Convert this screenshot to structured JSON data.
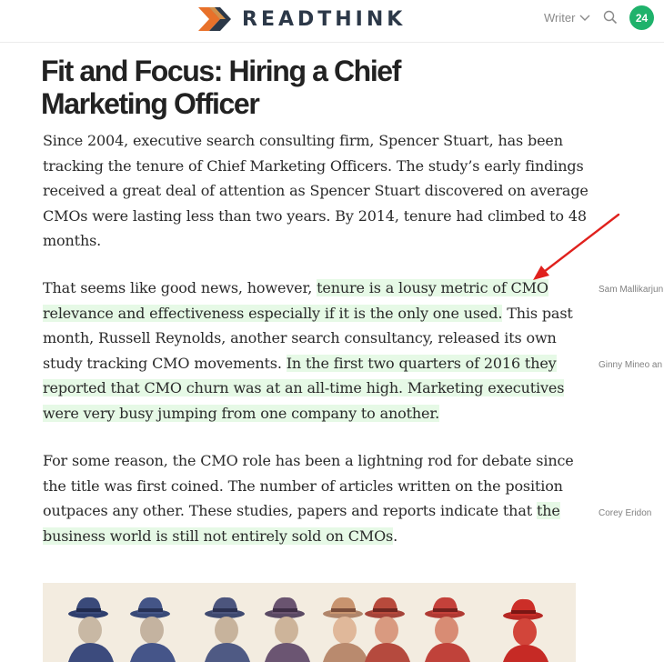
{
  "header": {
    "brand": "READTHINK",
    "writer_label": "Writer",
    "notification_count": "24",
    "brand_colors": {
      "primary": "#2c3848",
      "accent": "#e8712a"
    }
  },
  "article": {
    "title": "Fit and Focus: Hiring a Chief Marketing Officer",
    "paragraphs": [
      {
        "segments": [
          {
            "text": "Since 2004, executive search consulting firm, Spencer Stuart, has been tracking the tenure of Chief Marketing Officers. The study’s early findings received a great deal of attention as Spencer Stuart discovered on average CMOs were lasting less than two years. By 2014, tenure had climbed to 48 months.",
            "highlight": false
          }
        ]
      },
      {
        "segments": [
          {
            "text": "That seems like good news, however, ",
            "highlight": false
          },
          {
            "text": "tenure is a lousy metric of CMO relevance and effectiveness especially if it is the only one used.",
            "highlight": true
          },
          {
            "text": " This past month, Russell Reynolds, another search consultancy, released its own study tracking CMO movements. ",
            "highlight": false
          },
          {
            "text": "In the first two quarters of 2016 they reported that CMO churn was at an all-time high. Marketing executives were very busy jumping from one company to another.",
            "highlight": true
          }
        ]
      },
      {
        "segments": [
          {
            "text": "For some reason, the CMO role has been a lightning rod for debate since the title was first coined. The number of articles written on the position outpaces any other. These studies, papers and reports indicate that ",
            "highlight": false
          },
          {
            "text": "the business world is still not entirely sold on CMOs",
            "highlight": true
          },
          {
            "text": ".",
            "highlight": false
          }
        ]
      }
    ],
    "highlight_color": "#e6f9e6"
  },
  "highlight_authors": [
    "Sam Mallikarjun",
    "Ginny Mineo an",
    "Corey Eridon"
  ],
  "annotation": {
    "arrow_color": "#e0211d"
  },
  "image": {
    "icon": "vintage-hat-men-illustration"
  }
}
